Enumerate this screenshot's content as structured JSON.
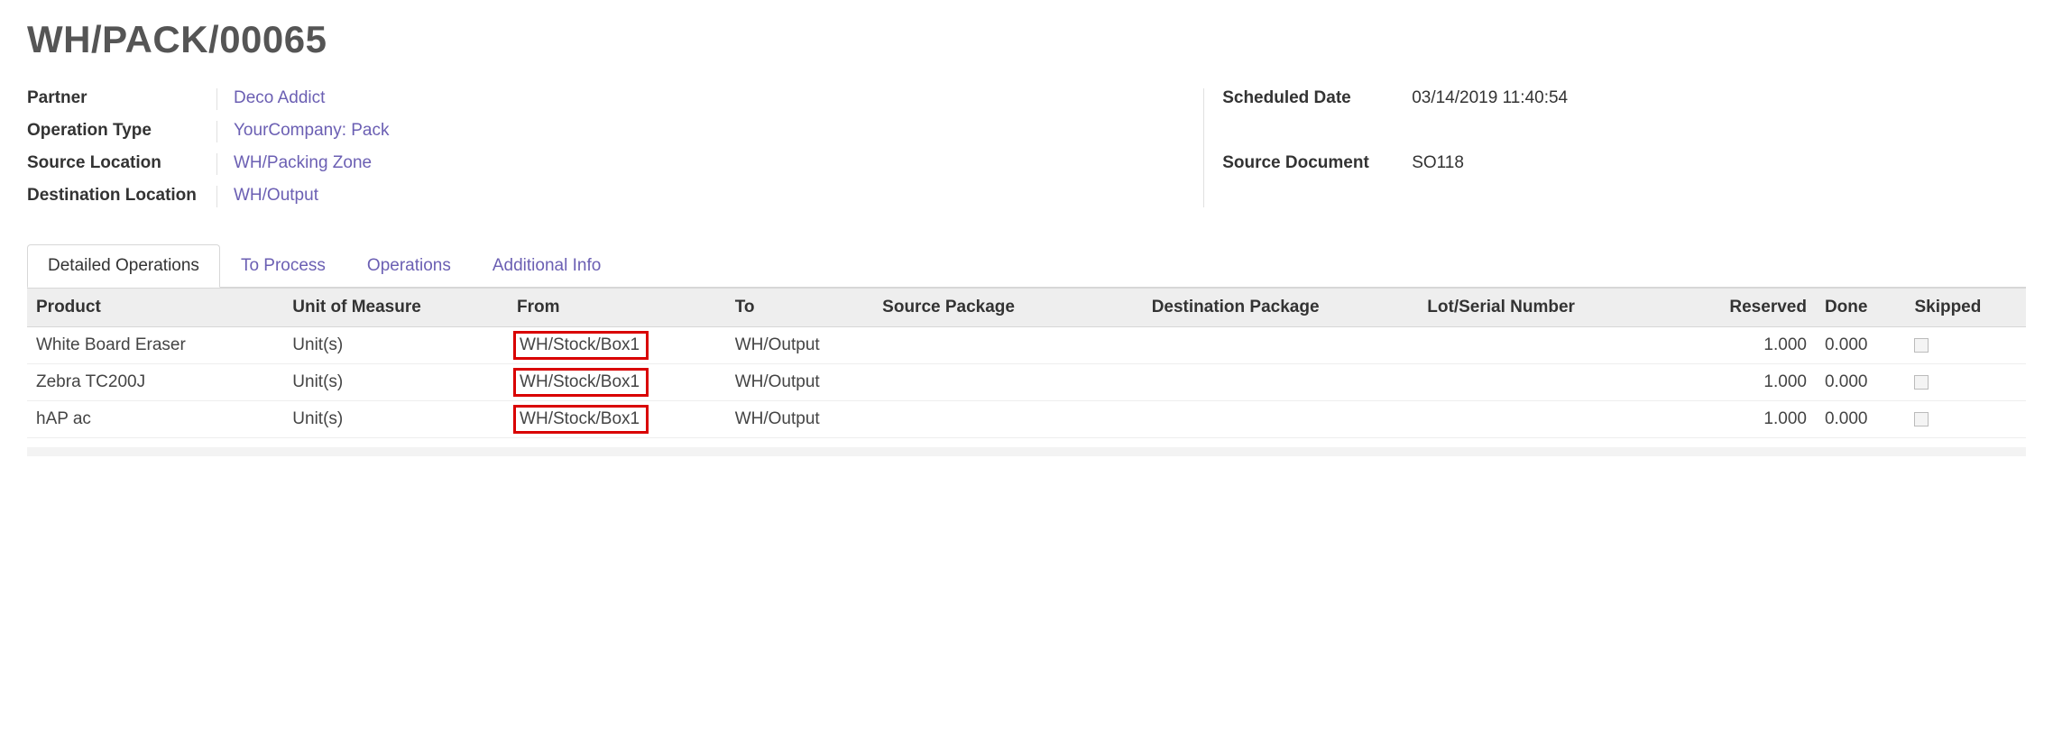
{
  "title": "WH/PACK/00065",
  "fields_left": {
    "partner_label": "Partner",
    "partner_value": "Deco Addict",
    "optype_label": "Operation Type",
    "optype_value": "YourCompany: Pack",
    "srcloc_label": "Source Location",
    "srcloc_value": "WH/Packing Zone",
    "dstloc_label": "Destination Location",
    "dstloc_value": "WH/Output"
  },
  "fields_right": {
    "sched_label": "Scheduled Date",
    "sched_value": "03/14/2019 11:40:54",
    "srcdoc_label": "Source Document",
    "srcdoc_value": "SO118"
  },
  "tabs": {
    "active": "Detailed Operations",
    "items": [
      "Detailed Operations",
      "To Process",
      "Operations",
      "Additional Info"
    ]
  },
  "columns": {
    "product": "Product",
    "uom": "Unit of Measure",
    "from": "From",
    "to": "To",
    "srcpkg": "Source Package",
    "dstpkg": "Destination Package",
    "lot": "Lot/Serial Number",
    "reserved": "Reserved",
    "done": "Done",
    "skipped": "Skipped"
  },
  "rows": [
    {
      "product": "White Board Eraser",
      "uom": "Unit(s)",
      "from": "WH/Stock/Box1",
      "to": "WH/Output",
      "srcpkg": "",
      "dstpkg": "",
      "lot": "",
      "reserved": "1.000",
      "done": "0.000",
      "skipped": false
    },
    {
      "product": "Zebra TC200J",
      "uom": "Unit(s)",
      "from": "WH/Stock/Box1",
      "to": "WH/Output",
      "srcpkg": "",
      "dstpkg": "",
      "lot": "",
      "reserved": "1.000",
      "done": "0.000",
      "skipped": false
    },
    {
      "product": "hAP ac",
      "uom": "Unit(s)",
      "from": "WH/Stock/Box1",
      "to": "WH/Output",
      "srcpkg": "",
      "dstpkg": "",
      "lot": "",
      "reserved": "1.000",
      "done": "0.000",
      "skipped": false
    }
  ]
}
